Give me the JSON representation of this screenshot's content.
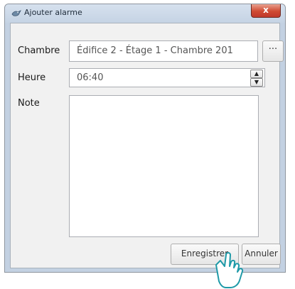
{
  "window": {
    "title": "Ajouter alarme",
    "close_glyph": "x"
  },
  "form": {
    "room_label": "Chambre",
    "room_value": "Édifice 2 - Étage 1 - Chambre 201",
    "browse_label": "···",
    "time_label": "Heure",
    "time_value": "06:40",
    "note_label": "Note",
    "note_value": ""
  },
  "actions": {
    "save_label": "Enregistrer",
    "cancel_label": "Annuler"
  },
  "icons": {
    "app": "bird-icon",
    "spin_up": "arrow-up-icon",
    "spin_down": "arrow-down-icon",
    "cursor": "hand-pointer-icon"
  }
}
